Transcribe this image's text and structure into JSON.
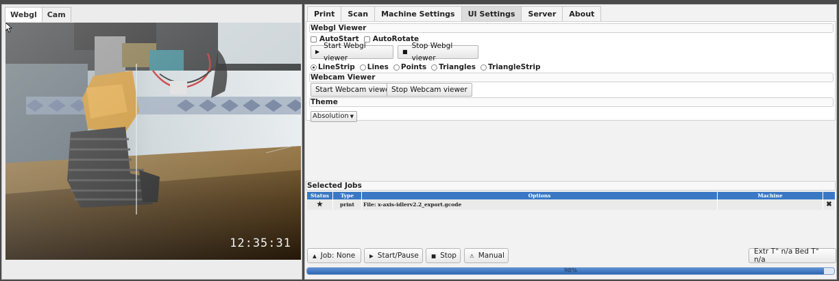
{
  "left_panel": {
    "tabs": [
      {
        "label": "Webgl",
        "active": true
      },
      {
        "label": "Cam",
        "active": false
      }
    ],
    "camera": {
      "timestamp": "12:35:31"
    }
  },
  "right_panel": {
    "tabs": [
      {
        "label": "Print",
        "active": false
      },
      {
        "label": "Scan",
        "active": false
      },
      {
        "label": "Machine Settings",
        "active": false
      },
      {
        "label": "UI Settings",
        "active": true
      },
      {
        "label": "Server",
        "active": false
      },
      {
        "label": "About",
        "active": false
      }
    ],
    "webgl": {
      "title": "Webgl Viewer",
      "autostart_label": "AutoStart",
      "autostart_checked": false,
      "autorotate_label": "AutoRotate",
      "autorotate_checked": false,
      "start_label": "Start Webgl viewer",
      "stop_label": "Stop Webgl viewer",
      "render_modes": [
        {
          "label": "LineStrip",
          "selected": true
        },
        {
          "label": "Lines",
          "selected": false
        },
        {
          "label": "Points",
          "selected": false
        },
        {
          "label": "Triangles",
          "selected": false
        },
        {
          "label": "TriangleStrip",
          "selected": false
        }
      ]
    },
    "webcam": {
      "title": "Webcam Viewer",
      "start_label": "Start Webcam viewer",
      "stop_label": "Stop Webcam viewer"
    },
    "theme": {
      "title": "Theme",
      "selected": "Absolution"
    },
    "jobs": {
      "title": "Selected Jobs",
      "columns": [
        "Status",
        "Type",
        "Options",
        "Machine"
      ],
      "rows": [
        {
          "status_icon": "star-icon",
          "type": "print",
          "options": "File: x-axis-idlerv2.2_export.gcode",
          "machine": ""
        }
      ]
    },
    "bottom": {
      "job_label": "Job: None",
      "start_pause_label": "Start/Pause",
      "stop_label": "Stop",
      "manual_label": "Manual",
      "temps_label": "Extr T° n/a Bed T° n/a"
    },
    "progress": {
      "percent_label": "98%",
      "value": 0.98
    }
  },
  "colors": {
    "accent": "#3a78c5",
    "progress_fill": "#2f66b0"
  }
}
